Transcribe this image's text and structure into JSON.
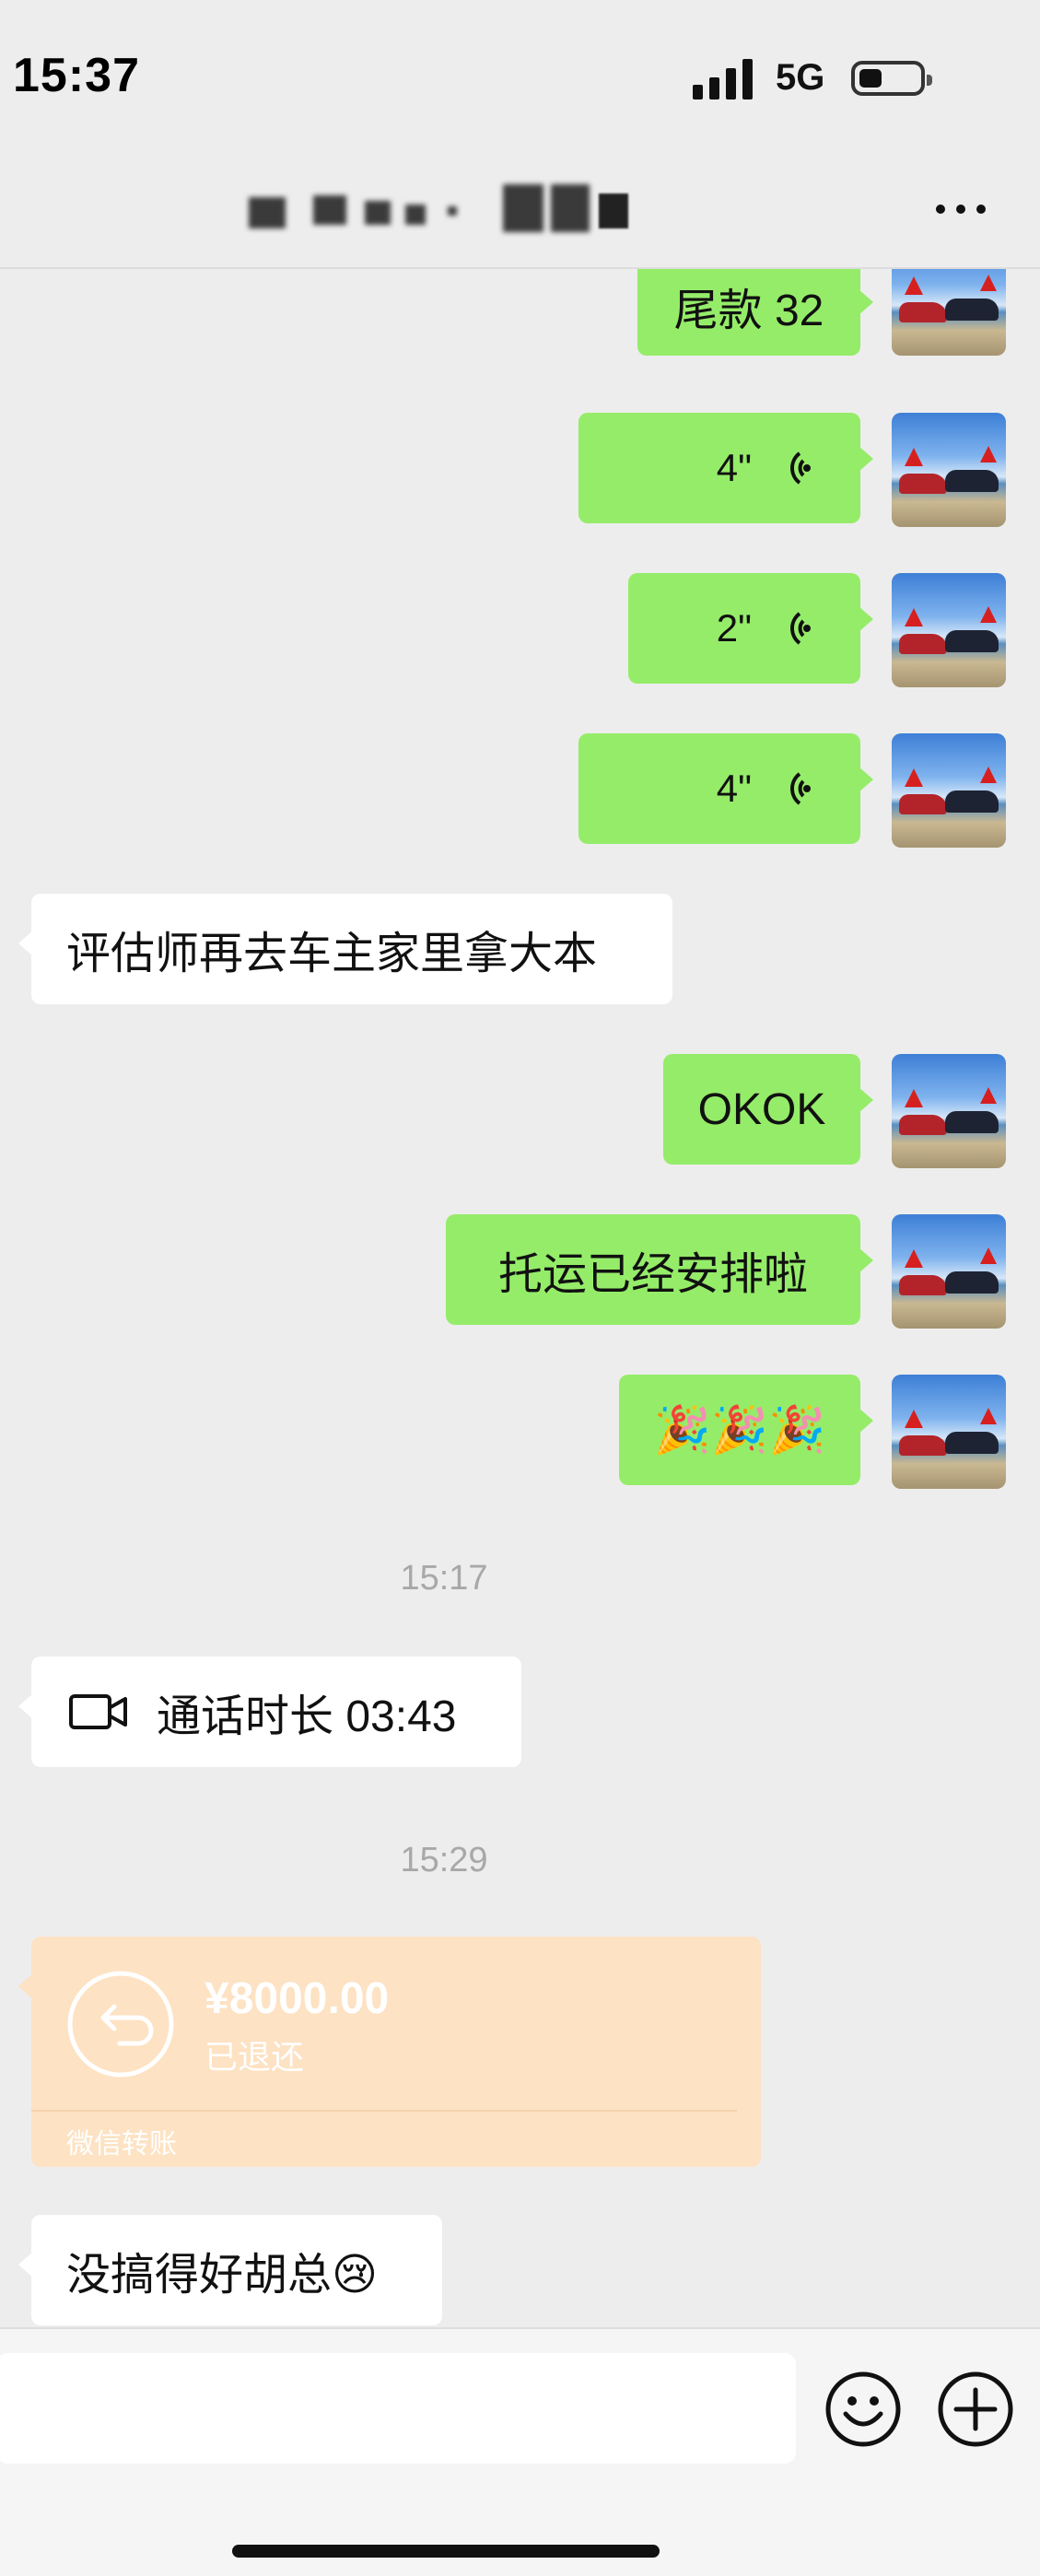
{
  "status_bar": {
    "time": "15:37",
    "network": "5G"
  },
  "header": {
    "title": ""
  },
  "messages": {
    "m1": "尾款 32",
    "m2": "4\"",
    "m3": "2\"",
    "m4": "4\"",
    "m5": "评估师再去车主家里拿大本",
    "m6": "OKOK",
    "m7": "托运已经安排啦",
    "m8": "🎉🎉🎉",
    "ts1": "15:17",
    "call": "通话时长 03:43",
    "ts2": "15:29",
    "last": "没搞得好胡总😢"
  },
  "transfer": {
    "amount": "¥8000.00",
    "status": "已退还",
    "brand": "微信转账"
  },
  "colors": {
    "sent_bubble": "#95ec69",
    "received_bubble": "#ffffff",
    "transfer_card": "#fde2c3",
    "background": "#ededed"
  },
  "icons": [
    "signal-icon",
    "battery-icon",
    "more-icon",
    "voice-wave-icon",
    "video-call-icon",
    "return-icon",
    "emoji-icon",
    "plus-icon"
  ]
}
